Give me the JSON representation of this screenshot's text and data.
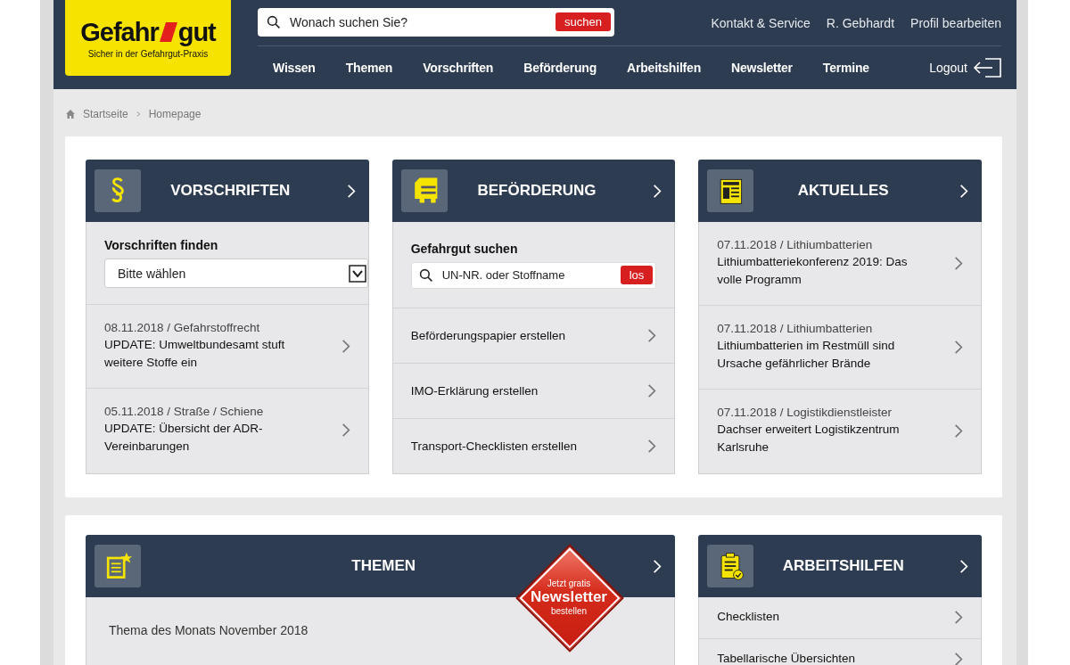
{
  "header": {
    "logo": {
      "word_left": "Gefahr",
      "word_right": "gut",
      "tagline": "Sicher in der Gefahrgut-Praxis"
    },
    "search": {
      "placeholder": "Wonach suchen Sie?",
      "button": "suchen"
    },
    "top_links": [
      "Kontakt & Service",
      "R. Gebhardt",
      "Profil bearbeiten"
    ],
    "nav": [
      "Wissen",
      "Themen",
      "Vorschriften",
      "Beförderung",
      "Arbeitshilfen",
      "Newsletter",
      "Termine"
    ],
    "logout": "Logout"
  },
  "breadcrumb": [
    "Startseite",
    "Homepage"
  ],
  "rows": [
    {
      "cards": [
        {
          "title": "VORSCHRIFTEN",
          "blocks": [
            {
              "kind": "select",
              "label": "Vorschriften finden",
              "value": "Bitte wählen"
            },
            {
              "kind": "news",
              "meta": "08.11.2018 / Gefahrstoffrecht",
              "text": "UPDATE: Umweltbundesamt stuft weitere Stoffe ein"
            },
            {
              "kind": "news",
              "meta": "05.11.2018 / Straße / Schiene",
              "text": "UPDATE: Übersicht der ADR-Vereinbarungen"
            }
          ]
        },
        {
          "title": "BEFÖRDERUNG",
          "blocks": [
            {
              "kind": "search",
              "label": "Gefahrgut suchen",
              "placeholder": "UN-NR. oder Stoffname",
              "button": "los"
            },
            {
              "kind": "link",
              "text": "Beförderungspapier erstellen"
            },
            {
              "kind": "link",
              "text": "IMO-Erklärung erstellen"
            },
            {
              "kind": "link",
              "text": "Transport-Checklisten erstellen"
            }
          ]
        },
        {
          "title": "AKTUELLES",
          "blocks": [
            {
              "kind": "news",
              "meta": "07.11.2018 / Lithiumbatterien",
              "text": "Lithiumbatteriekonferenz 2019: Das volle Programm"
            },
            {
              "kind": "news",
              "meta": "07.11.2018 / Lithiumbatterien",
              "text": "Lithiumbatterien im Restmüll sind Ursache gefährlicher Brände"
            },
            {
              "kind": "news",
              "meta": "07.11.2018 / Logistikdienstleister",
              "text": "Dachser erweitert Logistikzentrum Karlsruhe"
            }
          ]
        }
      ]
    },
    {
      "cards": [
        {
          "title": "THEMEN",
          "badge": [
            "Jetzt gratis",
            "Newsletter",
            "bestellen"
          ],
          "blocks": [
            {
              "kind": "text",
              "text": "Thema des Monats November 2018"
            }
          ]
        },
        {
          "title": "ARBEITSHILFEN",
          "blocks": [
            {
              "kind": "link",
              "text": "Checklisten"
            },
            {
              "kind": "link",
              "text": "Tabellarische Übersichten"
            }
          ]
        }
      ]
    }
  ]
}
